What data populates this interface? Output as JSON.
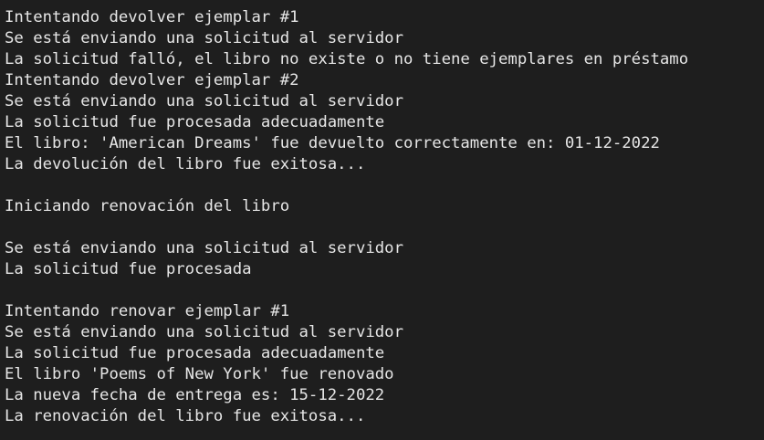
{
  "terminal": {
    "lines": [
      "Intentando devolver ejemplar #1",
      "Se está enviando una solicitud al servidor",
      "La solicitud falló, el libro no existe o no tiene ejemplares en préstamo",
      "Intentando devolver ejemplar #2",
      "Se está enviando una solicitud al servidor",
      "La solicitud fue procesada adecuadamente",
      "El libro: 'American Dreams' fue devuelto correctamente en: 01-12-2022",
      "La devolución del libro fue exitosa...",
      "",
      "Iniciando renovación del libro",
      "",
      "Se está enviando una solicitud al servidor",
      "La solicitud fue procesada",
      "",
      "Intentando renovar ejemplar #1",
      "Se está enviando una solicitud al servidor",
      "La solicitud fue procesada adecuadamente",
      "El libro 'Poems of New York' fue renovado",
      "La nueva fecha de entrega es: 15-12-2022",
      "La renovación del libro fue exitosa..."
    ]
  }
}
